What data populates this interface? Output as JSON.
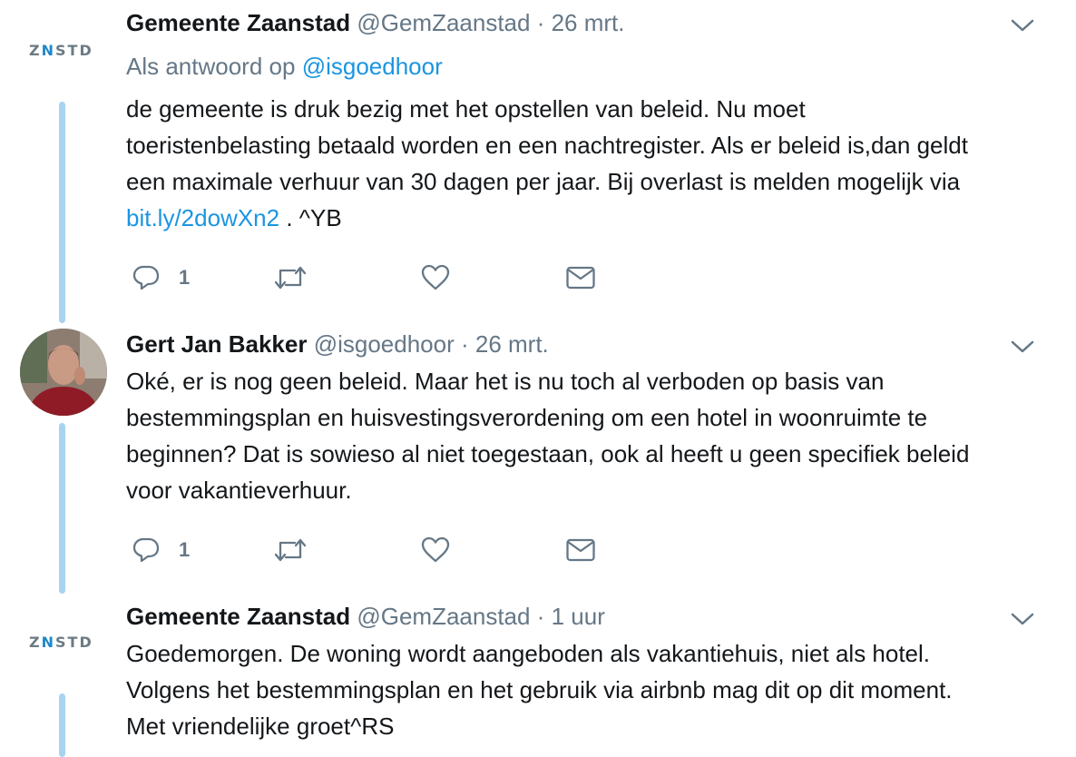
{
  "tweets": [
    {
      "author_logo": "ZNSTD",
      "name": "Gemeente Zaanstad",
      "handle": "@GemZaanstad",
      "time": "· 26 mrt.",
      "reply_prefix": "Als antwoord op",
      "reply_handle": "@isgoedhoor",
      "body_lines": [
        "de gemeente is druk bezig met het opstellen van beleid. Nu moet",
        "toeristenbelasting betaald worden en een nachtregister. Als er beleid is,dan geldt",
        "een maximale verhuur van 30 dagen per jaar. Bij overlast is melden mogelijk via"
      ],
      "body_link": "bit.ly/2dowXn2",
      "body_tail": " . ^YB",
      "reply_count": "1",
      "icons": [
        "reply-icon",
        "retweet-icon",
        "like-icon",
        "dm-icon",
        "chevron-down-icon"
      ]
    },
    {
      "name": "Gert Jan Bakker",
      "handle": "@isgoedhoor",
      "time": "· 26 mrt.",
      "body_lines": [
        "Oké, er is nog geen beleid. Maar het is nu toch al verboden op basis van",
        "bestemmingsplan en huisvestingsverordening om een hotel in woonruimte te",
        "beginnen? Dat is sowieso al niet toegestaan, ook al heeft u geen specifiek beleid",
        "voor vakantieverhuur."
      ],
      "reply_count": "1"
    },
    {
      "author_logo": "ZNSTD",
      "name": "Gemeente Zaanstad",
      "handle": "@GemZaanstad",
      "time": "· 1 uur",
      "body_lines": [
        "Goedemorgen. De woning wordt aangeboden als vakantiehuis, niet als hotel.",
        "Volgens het bestemmingsplan en het gebruik via airbnb mag dit op dit moment.",
        "Met vriendelijke groet^RS"
      ]
    }
  ],
  "colors": {
    "text": "#14171a",
    "muted": "#657786",
    "link": "#1b95e0",
    "thread_line": "#a8d3f1"
  }
}
